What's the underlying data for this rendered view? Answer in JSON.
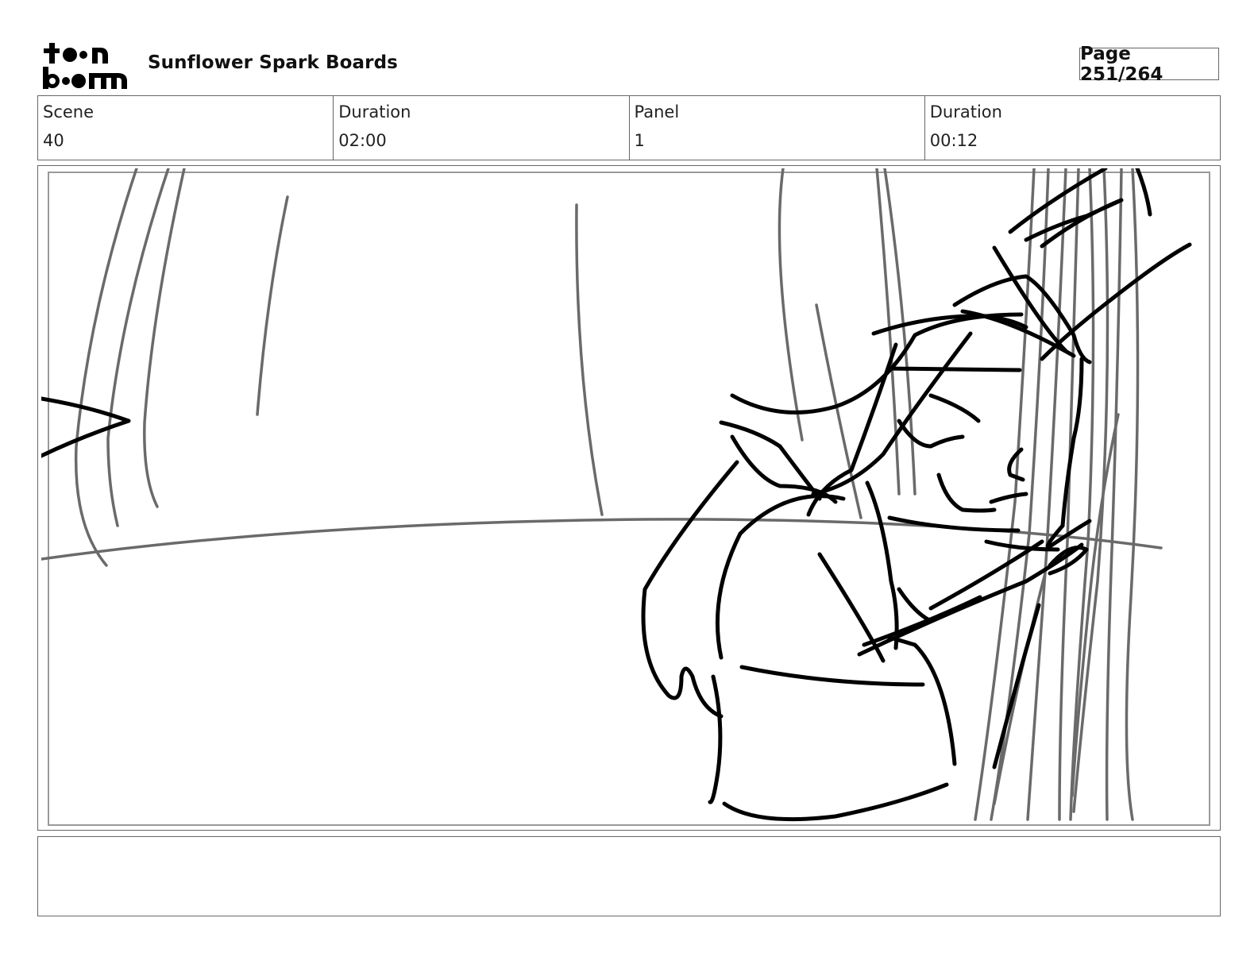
{
  "header": {
    "logo_text": "toon boom",
    "project_title": "Sunflower Spark Boards",
    "page_counter": "Page 251/264"
  },
  "panel_info": {
    "scene_label": "Scene",
    "scene_value": "40",
    "scene_duration_label": "Duration",
    "scene_duration_value": "02:00",
    "panel_label": "Panel",
    "panel_value": "1",
    "panel_duration_label": "Duration",
    "panel_duration_value": "00:12"
  },
  "notes": {
    "text": ""
  },
  "colors": {
    "ink": "#000000",
    "pencil_gray": "#6a6a6a",
    "frame_border": "#666666"
  }
}
